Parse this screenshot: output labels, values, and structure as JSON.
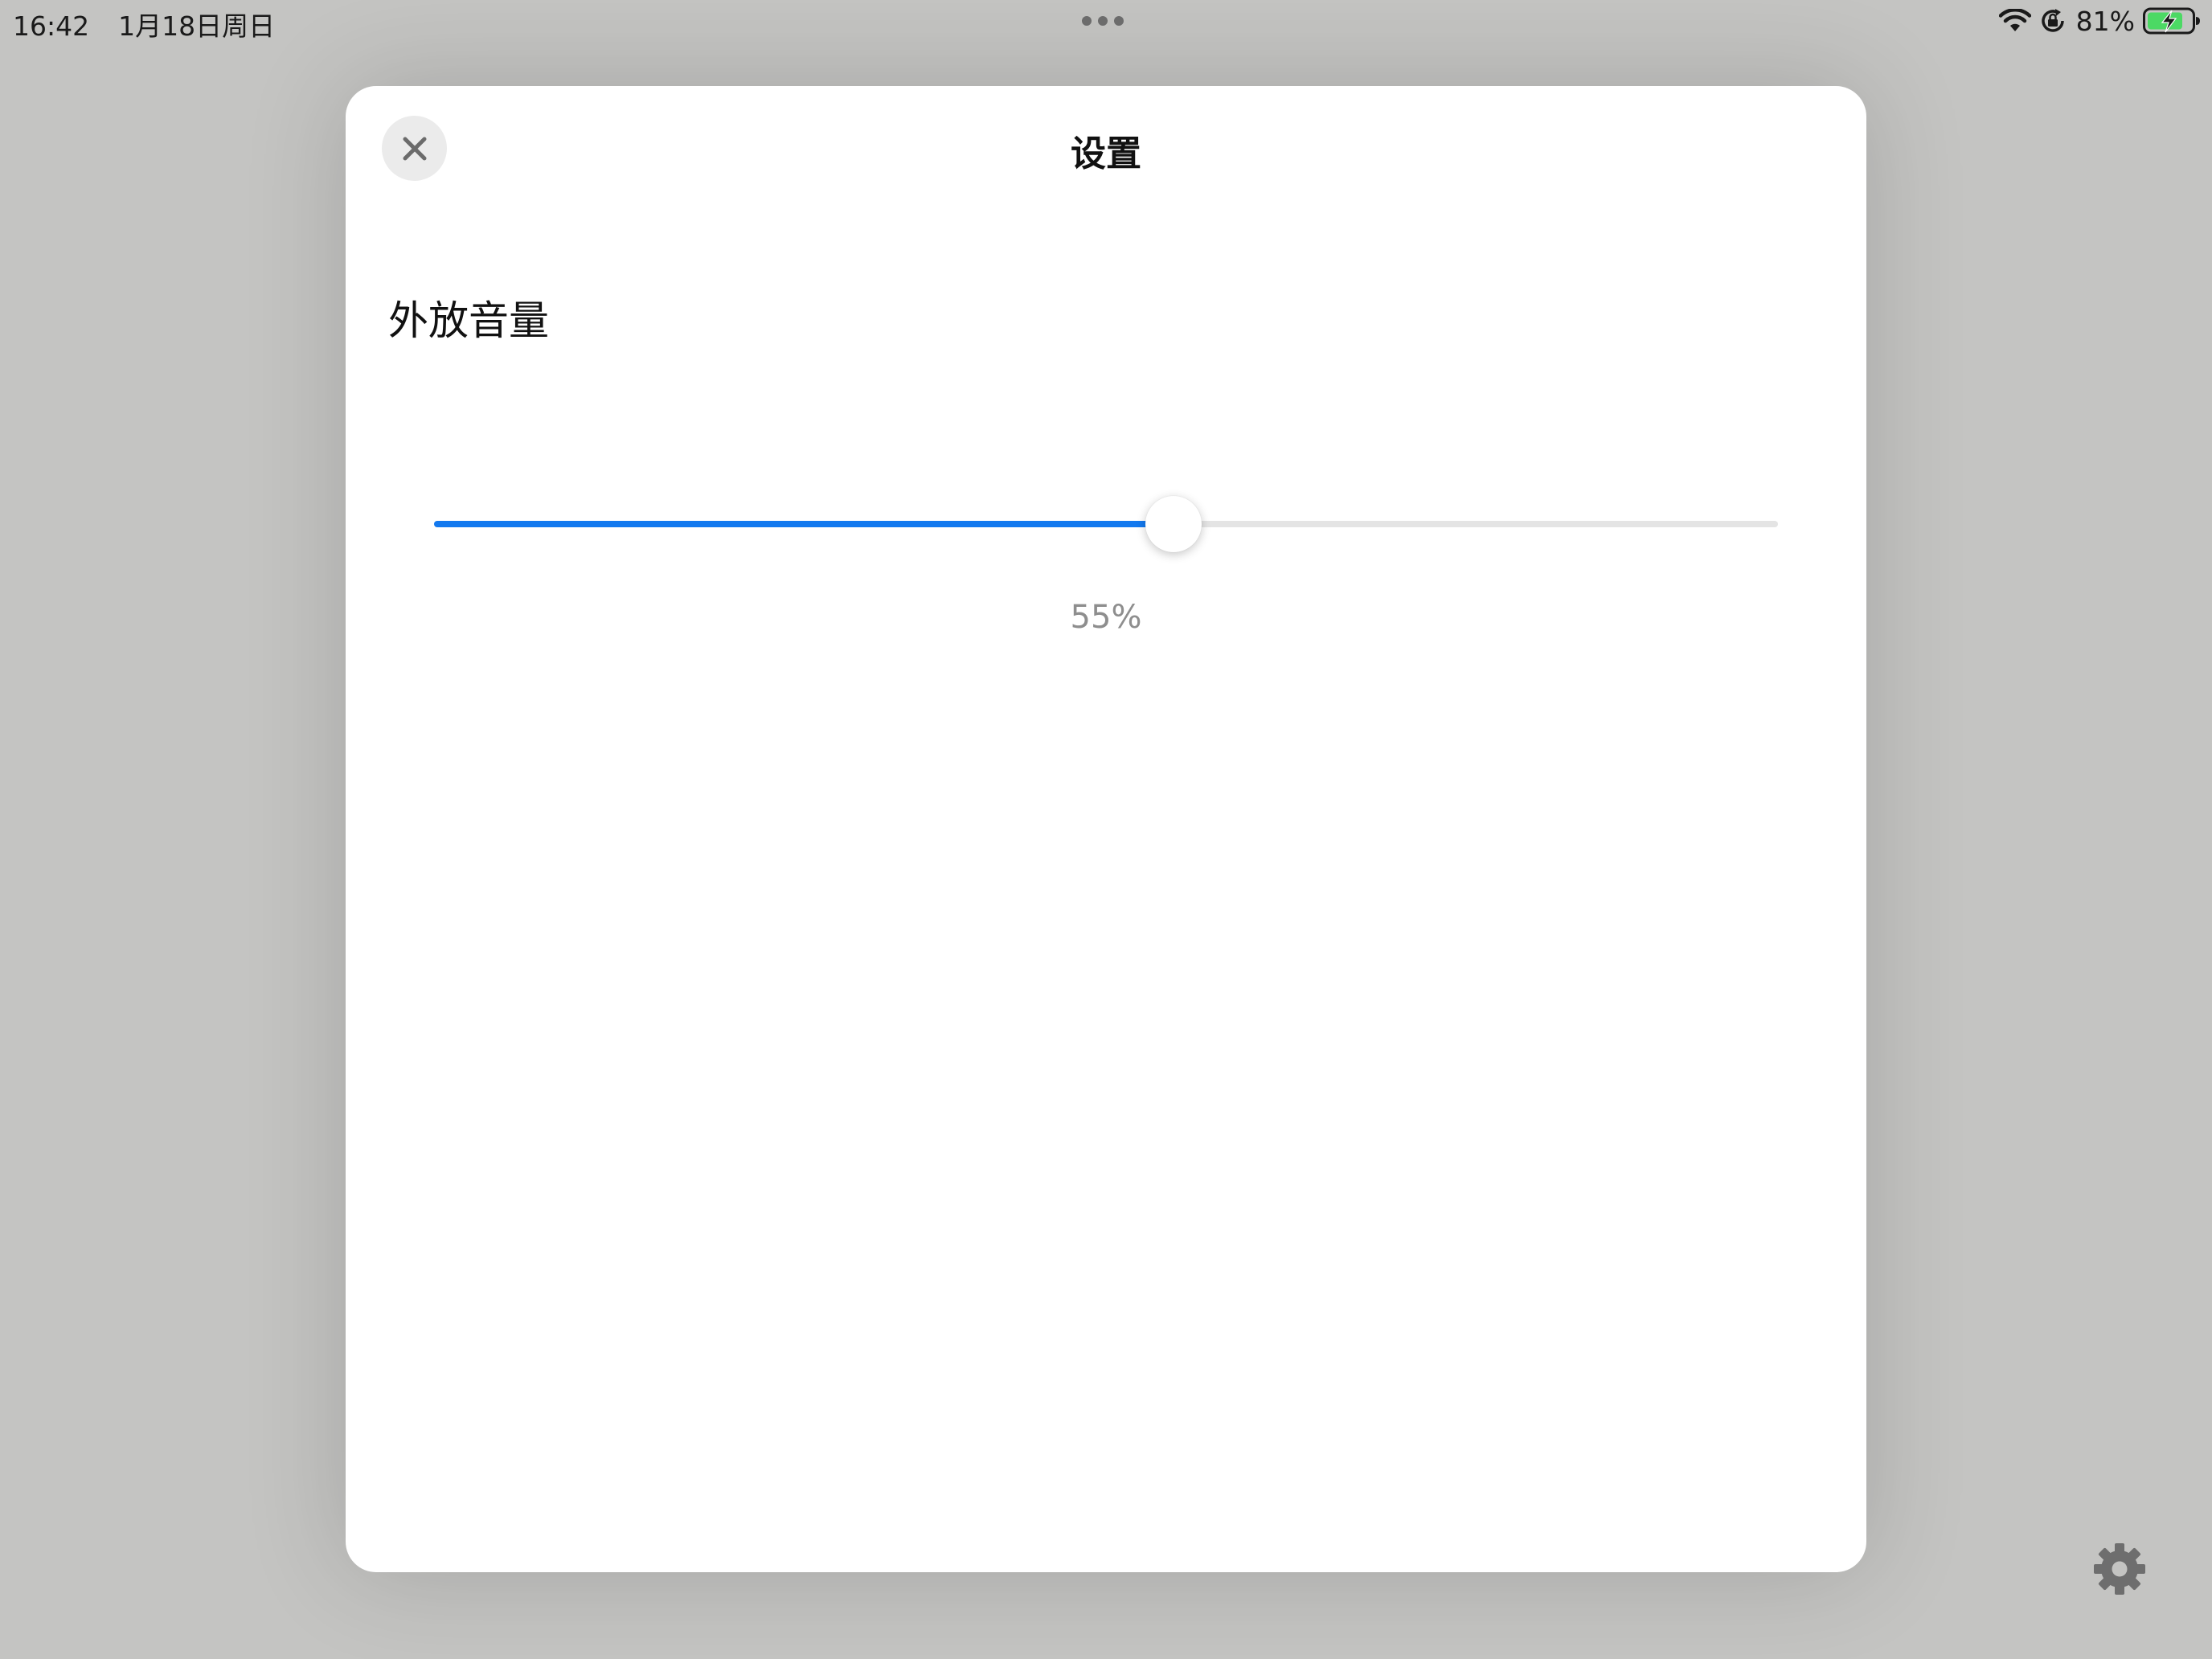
{
  "status_bar": {
    "time": "16:42",
    "date": "1月18日周日",
    "battery_percent": "81%",
    "icons": [
      "wifi-icon",
      "orientation-lock-icon",
      "battery-charging-icon"
    ]
  },
  "modal": {
    "title": "设置",
    "close_icon": "close-icon",
    "section_label": "外放音量",
    "volume": {
      "value": 0.55,
      "value_label": "55%"
    }
  },
  "settings_icon": "gear-icon",
  "colors": {
    "accent": "#1379EF",
    "battery_green": "#4CD964",
    "background": "#C4C4C2"
  }
}
